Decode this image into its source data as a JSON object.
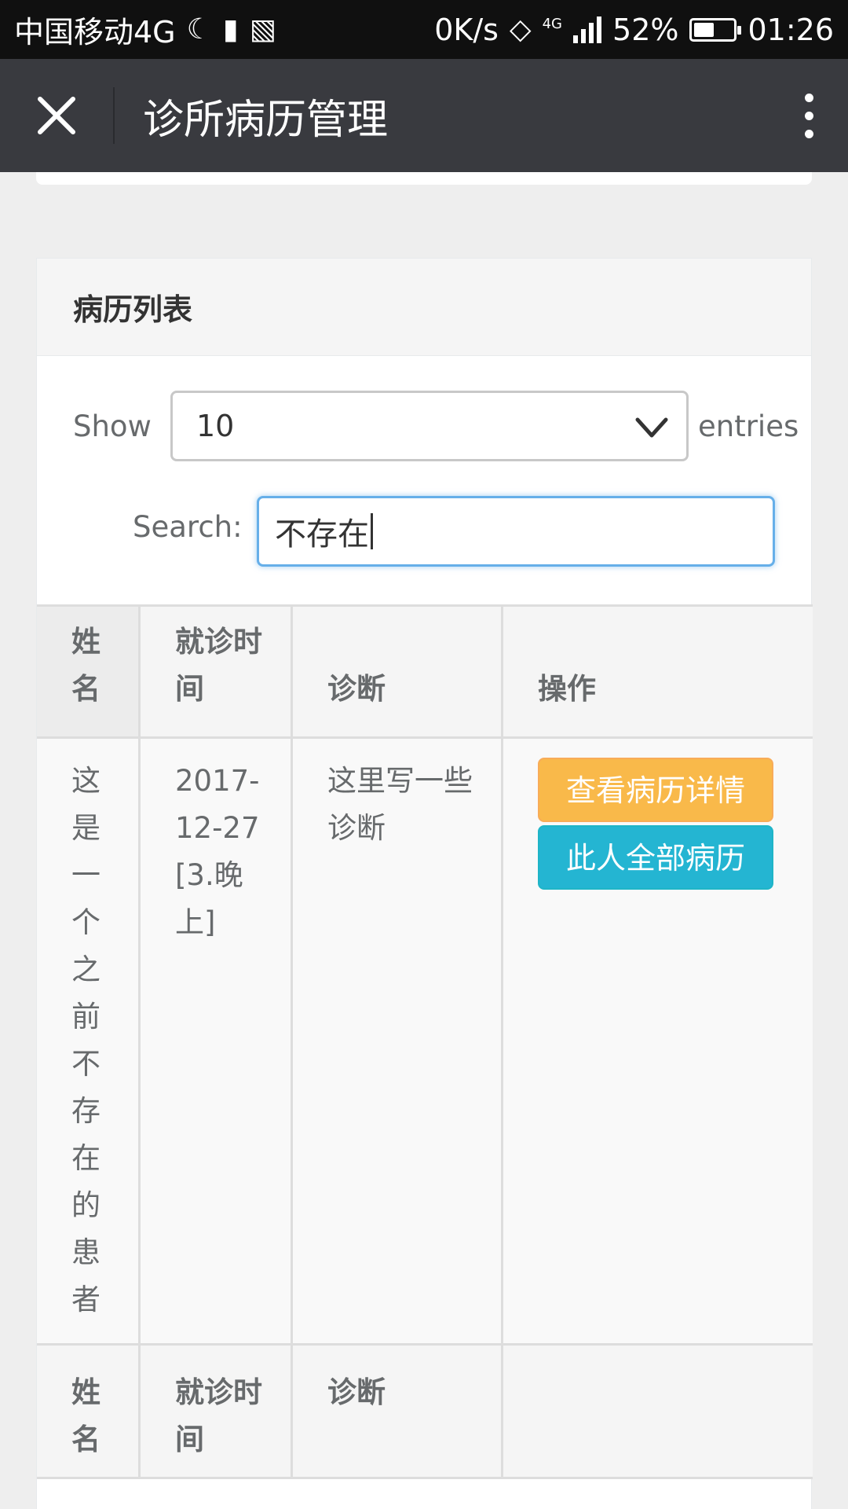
{
  "status_bar": {
    "carrier": "中国移动4G",
    "speed": "0K/s",
    "network": "4G",
    "battery": "52%",
    "battery_level": 0.52,
    "time": "01:26"
  },
  "app_bar": {
    "title": "诊所病历管理"
  },
  "panel": {
    "title": "病历列表"
  },
  "length": {
    "show_label": "Show",
    "selected": "10",
    "entries_label": "entries"
  },
  "search": {
    "label": "Search:",
    "value": "不存在"
  },
  "table": {
    "headers": [
      "姓名",
      "就诊时间",
      "诊断",
      "操作"
    ],
    "rows": [
      {
        "name": "这是一个之前不存在的患者",
        "time": "2017-12-27 [3.晚上]",
        "diagnosis": "这里写一些诊断",
        "actions": [
          "查看病历详情",
          "此人全部病历"
        ]
      }
    ],
    "footers": [
      "姓名",
      "就诊时间",
      "诊断",
      ""
    ]
  },
  "colors": {
    "app_bar": "#393a3f",
    "btn_warning": "#f9b94a",
    "btn_info": "#24b5d2",
    "search_focus": "#66afe9"
  }
}
